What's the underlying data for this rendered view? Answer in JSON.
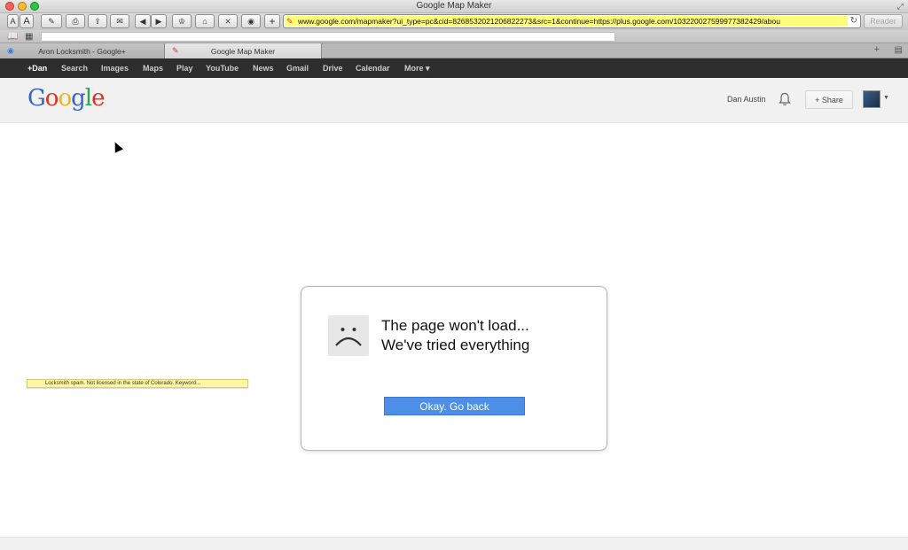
{
  "window": {
    "title": "Google Map Maker"
  },
  "toolbar": {
    "url": "www.google.com/mapmaker?ui_type=pc&cid=8268532021206822273&src=1&continue=https://plus.google.com/103220027599977382429/abou",
    "reader_label": "Reader",
    "buttons": [
      "A",
      "A",
      "✎",
      "⎙",
      "⇪",
      "✉",
      "◀",
      "▶",
      "♔",
      "⌂",
      "⨯",
      "◉",
      "+"
    ]
  },
  "tabs": [
    {
      "label": "Aron Locksmith - Google+",
      "active": false
    },
    {
      "label": "Google Map Maker",
      "active": true
    }
  ],
  "gbar": {
    "items": [
      "+Dan",
      "Search",
      "Images",
      "Maps",
      "Play",
      "YouTube",
      "News",
      "Gmail",
      "Drive",
      "Calendar",
      "More ▾"
    ]
  },
  "header": {
    "logo": {
      "letters": [
        "G",
        "o",
        "o",
        "g",
        "l",
        "e"
      ],
      "colors": [
        "#3366cc",
        "#dd3322",
        "#f2b50f",
        "#3366cc",
        "#2ea84c",
        "#dd3322"
      ]
    },
    "username": "Dan Austin",
    "share_label": "+ Share"
  },
  "note": {
    "text": "Locksmith spam.  Not licensed in the state of Colorado.  Keyword..."
  },
  "dialog": {
    "line1": "The page won't load...",
    "line2": "We've tried everything",
    "button_label": "Okay. Go back"
  },
  "icons": {
    "bell": "bell-icon",
    "sad_face": "sad-face-icon",
    "reload": "reload-icon"
  }
}
